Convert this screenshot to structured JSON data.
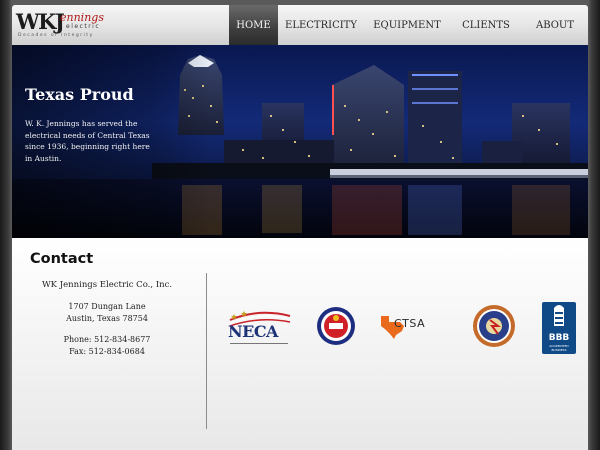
{
  "header": {
    "logo": {
      "wk": "WKJ",
      "jennings": "ennings",
      "electric": "electric",
      "tagline": "Decades of Integrity"
    },
    "nav": [
      {
        "label": "HOME",
        "active": true
      },
      {
        "label": "ELECTRICITY",
        "active": false
      },
      {
        "label": "EQUIPMENT",
        "active": false
      },
      {
        "label": "CLIENTS",
        "active": false
      },
      {
        "label": "ABOUT",
        "active": false
      }
    ]
  },
  "hero": {
    "title": "Texas Proud",
    "text": "W. K. Jennings has served the electrical needs of Central Texas since 1936, beginning right here in Austin."
  },
  "contact": {
    "title": "Contact",
    "company": "WK Jennings Electric Co., Inc.",
    "address_line1": "1707 Dungan Lane",
    "address_line2": "Austin, Texas 78754",
    "phone": "Phone: 512-834-8677",
    "fax": "Fax: 512-834-0684"
  },
  "affiliations": {
    "neca": "NECA",
    "ctsa": "CTSA",
    "bbb": "BBB",
    "bbb_sub": "ACCREDITED BUSINESS"
  },
  "colors": {
    "accent_red": "#b01818",
    "nav_active": "#3e3e3e",
    "hero_blue": "#132a78",
    "neca_blue": "#1e3276",
    "bbb_blue": "#0f4a86"
  }
}
